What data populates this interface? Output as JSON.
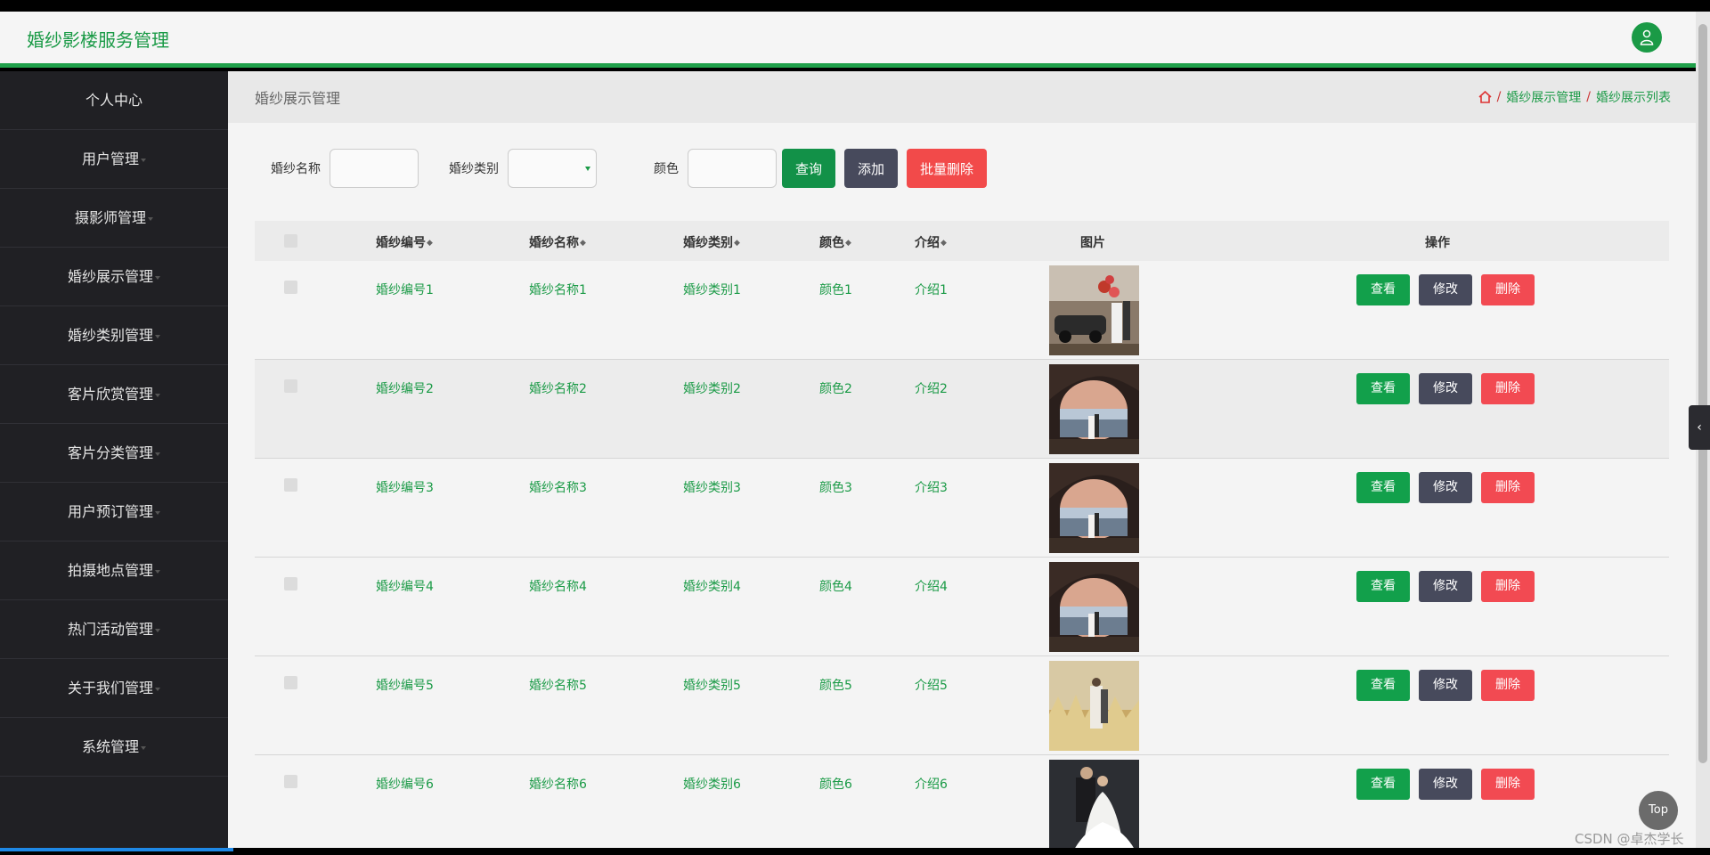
{
  "app": {
    "title": "婚纱影楼服务管理"
  },
  "sidebar": {
    "items": [
      {
        "label": "个人中心"
      },
      {
        "label": "用户管理"
      },
      {
        "label": "摄影师管理"
      },
      {
        "label": "婚纱展示管理"
      },
      {
        "label": "婚纱类别管理"
      },
      {
        "label": "客片欣赏管理"
      },
      {
        "label": "客片分类管理"
      },
      {
        "label": "用户预订管理"
      },
      {
        "label": "拍摄地点管理"
      },
      {
        "label": "热门活动管理"
      },
      {
        "label": "关于我们管理"
      },
      {
        "label": "系统管理"
      }
    ]
  },
  "page": {
    "title": "婚纱展示管理",
    "breadcrumb": [
      "婚纱展示管理",
      "婚纱展示列表"
    ]
  },
  "search": {
    "name_label": "婚纱名称",
    "category_label": "婚纱类别",
    "color_label": "颜色",
    "query": "查询",
    "add": "添加",
    "bulk_delete": "批量删除"
  },
  "table": {
    "headers": [
      "婚纱编号",
      "婚纱名称",
      "婚纱类别",
      "颜色",
      "介绍",
      "图片",
      "操作"
    ],
    "actions": {
      "view": "查看",
      "edit": "修改",
      "delete": "删除"
    },
    "rows": [
      {
        "code": "婚纱编号1",
        "name": "婚纱名称1",
        "category": "婚纱类别1",
        "color": "颜色1",
        "intro": "介绍1",
        "image": "car-couple"
      },
      {
        "code": "婚纱编号2",
        "name": "婚纱名称2",
        "category": "婚纱类别2",
        "color": "颜色2",
        "intro": "介绍2",
        "image": "cave-sunset"
      },
      {
        "code": "婚纱编号3",
        "name": "婚纱名称3",
        "category": "婚纱类别3",
        "color": "颜色3",
        "intro": "介绍3",
        "image": "cave-sunset"
      },
      {
        "code": "婚纱编号4",
        "name": "婚纱名称4",
        "category": "婚纱类别4",
        "color": "颜色4",
        "intro": "介绍4",
        "image": "cave-sunset"
      },
      {
        "code": "婚纱编号5",
        "name": "婚纱名称5",
        "category": "婚纱类别5",
        "color": "颜色5",
        "intro": "介绍5",
        "image": "field-gold"
      },
      {
        "code": "婚纱编号6",
        "name": "婚纱名称6",
        "category": "婚纱类别6",
        "color": "颜色6",
        "intro": "介绍6",
        "image": "studio-dark"
      }
    ]
  },
  "ui": {
    "top": "Top",
    "watermark": "CSDN @卓杰学长"
  },
  "colors": {
    "accent": "#1a9a46",
    "sidebar": "#202024",
    "danger": "#f24a4a",
    "neutral": "#474a5c"
  }
}
